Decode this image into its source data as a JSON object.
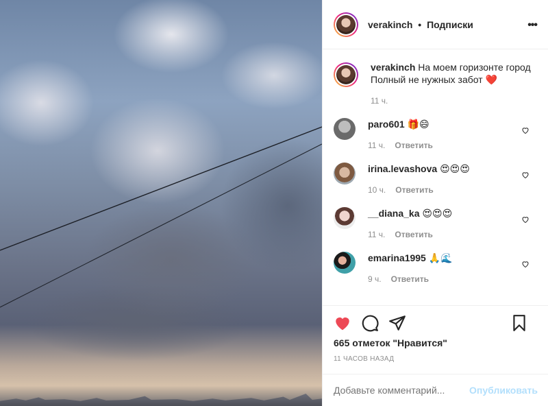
{
  "post": {
    "username": "verakinch",
    "dot": "•",
    "follow_label": "Подписки",
    "more_icon": "more-horizontal-icon"
  },
  "caption": {
    "username": "verakinch",
    "text": "На моем горизонте город Полный не нужных забот",
    "emoji": "❤️",
    "time": "11 ч."
  },
  "comments": [
    {
      "username": "paro601",
      "text": "🎁😄",
      "time": "11 ч.",
      "reply": "Ответить"
    },
    {
      "username": "irina.levashova",
      "text": "😍😍😍",
      "time": "10 ч.",
      "reply": "Ответить"
    },
    {
      "username": "__diana_ka",
      "text": "😍😍😍",
      "time": "11 ч.",
      "reply": "Ответить"
    },
    {
      "username": "emarina1995",
      "text": "🙏🌊",
      "time": "9 ч.",
      "reply": "Ответить"
    }
  ],
  "actions": {
    "likes": "665 отметок \"Нравится\"",
    "timestamp": "11 ЧАСОВ НАЗАД",
    "like_color": "#ed4956"
  },
  "add_comment": {
    "placeholder": "Добавьте комментарий...",
    "post_label": "Опубликовать"
  }
}
